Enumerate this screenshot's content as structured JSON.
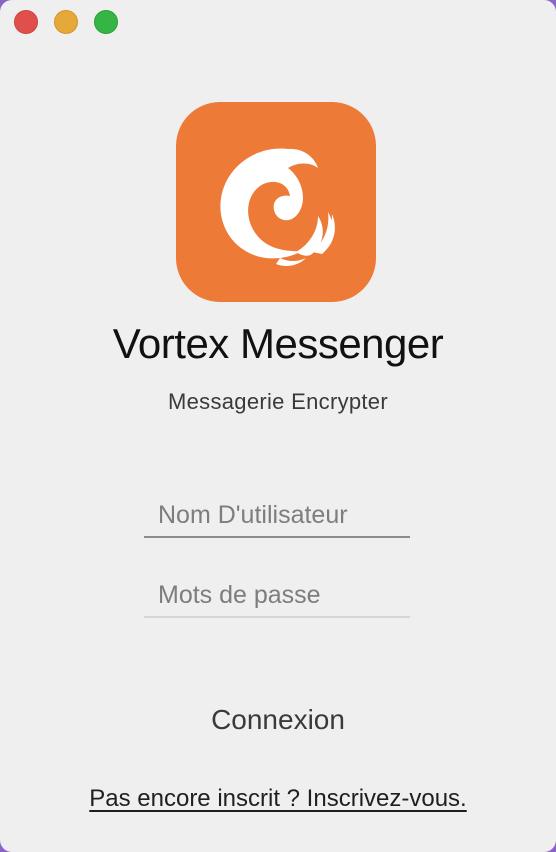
{
  "window": {
    "controls": [
      "close",
      "minimize",
      "zoom"
    ]
  },
  "app": {
    "icon": "vortex-logo-icon",
    "title": "Vortex Messenger",
    "subtitle": "Messagerie Encrypter",
    "accent_color": "#ed7a37"
  },
  "form": {
    "username_placeholder": "Nom D'utilisateur",
    "username_value": "",
    "password_placeholder": "Mots de passe",
    "password_value": "",
    "login_label": "Connexion"
  },
  "footer": {
    "signup_link": "Pas encore inscrit ? Inscrivez-vous."
  }
}
